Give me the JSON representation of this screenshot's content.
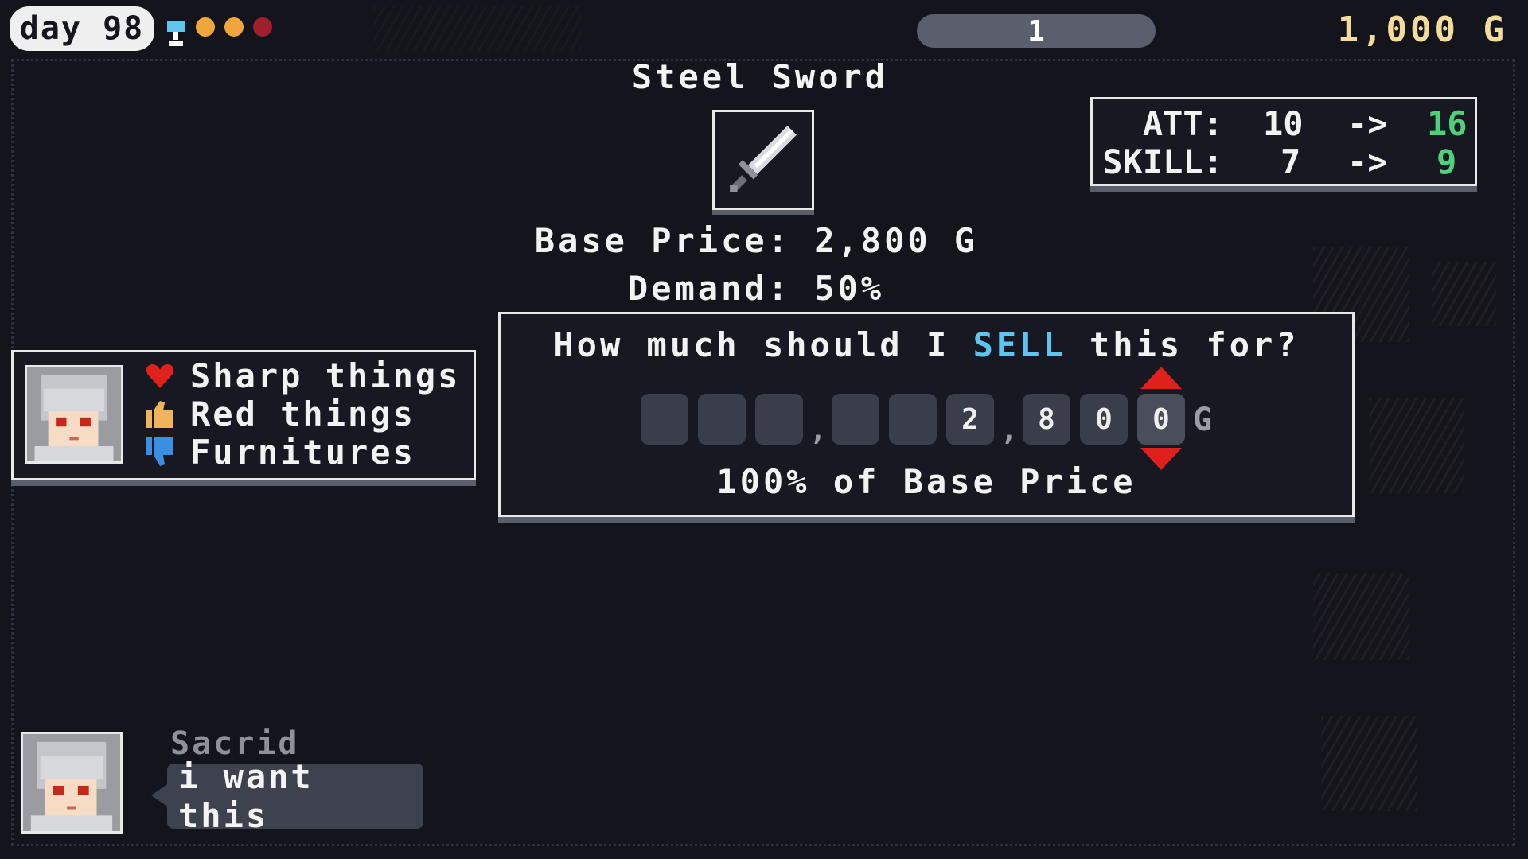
{
  "hud": {
    "day_label": "day 98",
    "counter": "1",
    "gold": "1,000 G",
    "status_dots": [
      "#f0a63a",
      "#f0a63a",
      "#a01f2e"
    ]
  },
  "item": {
    "name": "Steel Sword",
    "icon": "sword-icon",
    "base_price_text": "Base Price: 2,800 G",
    "demand_text": "Demand: 50%"
  },
  "stats": [
    {
      "label": "ATT:",
      "from": "10",
      "arrow": "->",
      "to": "16"
    },
    {
      "label": "SKILL:",
      "from": "7",
      "arrow": "->",
      "to": "9"
    }
  ],
  "customer": {
    "name": "Sacrid",
    "message": "i want this",
    "preferences": [
      {
        "icon": "heart-icon",
        "label": "Sharp things"
      },
      {
        "icon": "thumbs-up-icon",
        "label": "Red things"
      },
      {
        "icon": "thumbs-down-icon",
        "label": "Furnitures"
      }
    ]
  },
  "sell_dialog": {
    "question_before": "How much should I",
    "question_highlight": "SELL",
    "question_after": "this for?",
    "digits": [
      "",
      "",
      "",
      "",
      "",
      "2",
      "8",
      "0",
      "0"
    ],
    "separators": [
      ",",
      ","
    ],
    "currency": "G",
    "percent_text": "100% of Base Price",
    "highlight_color": "#5ec5f0",
    "arrow_color": "#e0201c"
  }
}
